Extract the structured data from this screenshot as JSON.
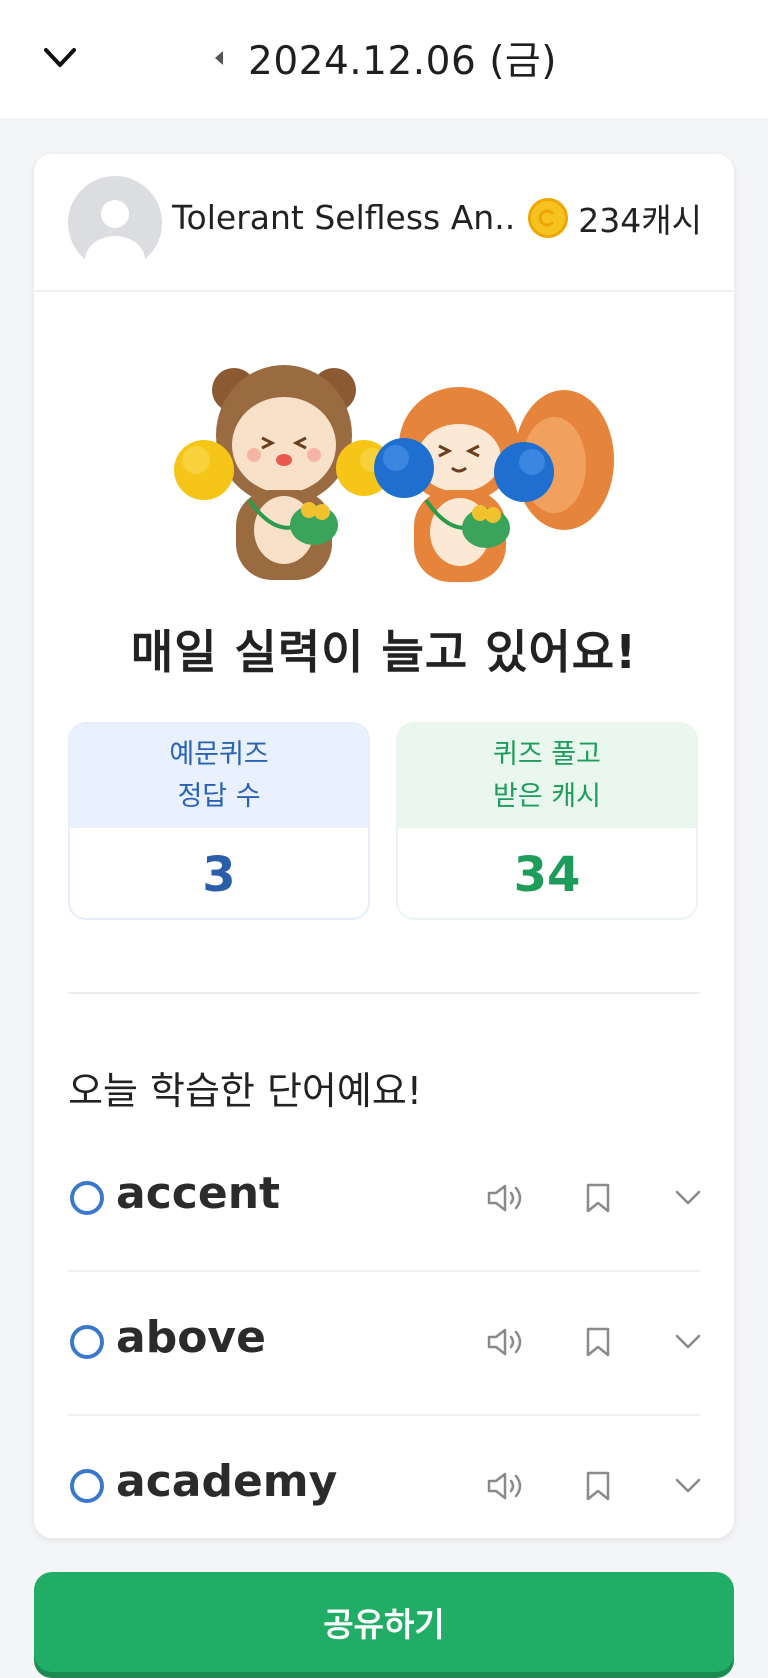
{
  "header": {
    "date": "2024.12.06 (금)"
  },
  "profile": {
    "name": "Tolerant Selfless An...",
    "cash": "234캐시"
  },
  "headline": "매일 실력이 늘고 있어요!",
  "stats": [
    {
      "label_line1": "예문퀴즈",
      "label_line2": "정답 수",
      "value": "3",
      "color": "#2a5ea8"
    },
    {
      "label_line1": "퀴즈 풀고",
      "label_line2": "받은 캐시",
      "value": "34",
      "color": "#1e9c5c"
    }
  ],
  "words_section": {
    "title": "오늘 학습한 단어예요!",
    "words": [
      "accent",
      "above",
      "academy"
    ]
  },
  "share_button": "공유하기",
  "colors": {
    "accent_green": "#22ad67",
    "accent_blue": "#3a78c9",
    "coin": "#f6c21f"
  }
}
